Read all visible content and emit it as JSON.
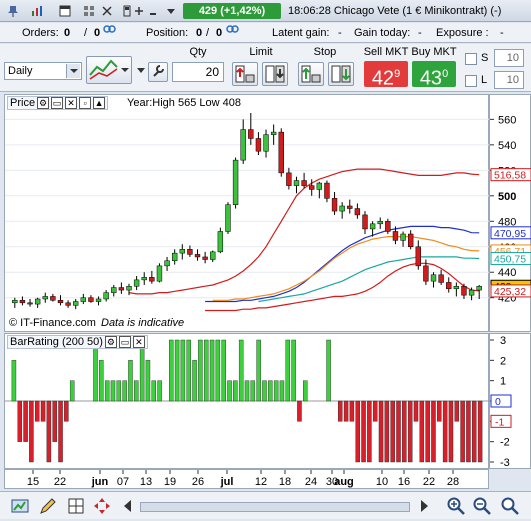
{
  "titlebar": {
    "price": "429 (+1,42%)",
    "title": "18:06:28 Chicago Vete (1 € Minikontrakt) (-)",
    "icons": [
      "pin-icon",
      "chart-icon",
      "window-icon",
      "tile-icon",
      "close-icon",
      "arrow-up-icon",
      "arrow-down-icon",
      "restore-icon",
      "more-icon"
    ]
  },
  "infobar": {
    "orders_label": "Orders:",
    "orders_val1": "0",
    "orders_val2": "0",
    "position_label": "Position:",
    "position_val1": "0",
    "position_val2": "0",
    "latent_label": "Latent gain:",
    "latent_val": "-",
    "gain_label": "Gain today:",
    "gain_val": "-",
    "exposure_label": "Exposure :",
    "exposure_val": "-",
    "sep": "/"
  },
  "toolbar": {
    "period": "Daily",
    "qty_label": "Qty",
    "qty_value": "20",
    "limit_label": "Limit",
    "stop_label": "Stop",
    "sell_label": "Sell MKT",
    "buy_label": "Buy MKT",
    "sell_price_main": "42",
    "sell_price_sup": "9",
    "buy_price_main": "43",
    "buy_price_sup": "0",
    "s_label": "S",
    "l_label": "L",
    "s_value": "10",
    "l_value": "10"
  },
  "price_panel": {
    "title": "Price",
    "info": "Year:High 565 Low 408",
    "copyright": "© IT-Finance.com",
    "indicative": "Data is indicative",
    "yticks": [
      "560",
      "540",
      "520",
      "500",
      "480",
      "460",
      "440",
      "420"
    ],
    "tags": [
      {
        "text": "516,58",
        "color": "#d01c1c",
        "value": 516.58
      },
      {
        "text": "470,95",
        "color": "#1d2fd0",
        "value": 470.95
      },
      {
        "text": "456,71",
        "color": "#f08a1a",
        "value": 456.71
      },
      {
        "text": "450,75",
        "color": "#1aa7a0",
        "value": 450.75
      },
      {
        "text": "429",
        "color": "#000000",
        "value": 429,
        "bg": "#f5c400"
      },
      {
        "text": "425,32",
        "color": "#d01c1c",
        "value": 425.32
      }
    ]
  },
  "bar_panel": {
    "title": "BarRating (200 50)",
    "yticks": [
      "3",
      "2",
      "1",
      "0",
      "-1",
      "-2",
      "-3"
    ],
    "zero_tag": "0",
    "neg_tag": "-1"
  },
  "xaxis": {
    "labels": [
      "15",
      "22",
      "jun",
      "07",
      "13",
      "19",
      "26",
      "jul",
      "12",
      "18",
      "24",
      "30",
      "aug",
      "10",
      "16",
      "22",
      "28"
    ]
  },
  "chart_data": {
    "type": "line",
    "title": "",
    "info": "Year:High 565 Low 408",
    "ylim": [
      408,
      565
    ],
    "x_labels": [
      "15",
      "22",
      "jun",
      "07",
      "13",
      "19",
      "26",
      "jul",
      "12",
      "18",
      "24",
      "30",
      "aug",
      "10",
      "16",
      "22",
      "28"
    ],
    "candles": [
      [
        416,
        420,
        412,
        418
      ],
      [
        418,
        421,
        414,
        416
      ],
      [
        416,
        419,
        413,
        415
      ],
      [
        415,
        420,
        412,
        419
      ],
      [
        419,
        424,
        416,
        421
      ],
      [
        421,
        423,
        417,
        418
      ],
      [
        418,
        422,
        414,
        416
      ],
      [
        416,
        418,
        412,
        414
      ],
      [
        414,
        419,
        411,
        417
      ],
      [
        417,
        423,
        415,
        420
      ],
      [
        420,
        422,
        416,
        417
      ],
      [
        417,
        421,
        414,
        419
      ],
      [
        419,
        426,
        417,
        424
      ],
      [
        424,
        430,
        421,
        428
      ],
      [
        428,
        432,
        423,
        426
      ],
      [
        426,
        431,
        422,
        429
      ],
      [
        429,
        437,
        426,
        434
      ],
      [
        434,
        440,
        430,
        436
      ],
      [
        436,
        441,
        431,
        433
      ],
      [
        433,
        447,
        432,
        445
      ],
      [
        445,
        452,
        441,
        449
      ],
      [
        449,
        458,
        446,
        455
      ],
      [
        455,
        462,
        450,
        458
      ],
      [
        458,
        461,
        452,
        454
      ],
      [
        454,
        458,
        449,
        452
      ],
      [
        452,
        456,
        447,
        450
      ],
      [
        450,
        457,
        448,
        456
      ],
      [
        456,
        475,
        455,
        472
      ],
      [
        472,
        495,
        470,
        493
      ],
      [
        493,
        530,
        490,
        528
      ],
      [
        528,
        560,
        525,
        552
      ],
      [
        552,
        565,
        540,
        545
      ],
      [
        545,
        550,
        532,
        535
      ],
      [
        535,
        552,
        530,
        548
      ],
      [
        548,
        556,
        540,
        550
      ],
      [
        550,
        553,
        515,
        518
      ],
      [
        518,
        522,
        505,
        508
      ],
      [
        508,
        515,
        502,
        512
      ],
      [
        512,
        518,
        506,
        508
      ],
      [
        508,
        513,
        500,
        505
      ],
      [
        505,
        511,
        498,
        510
      ],
      [
        510,
        512,
        495,
        498
      ],
      [
        498,
        503,
        485,
        488
      ],
      [
        488,
        495,
        482,
        492
      ],
      [
        492,
        497,
        486,
        490
      ],
      [
        490,
        494,
        482,
        485
      ],
      [
        485,
        488,
        470,
        474
      ],
      [
        474,
        480,
        468,
        478
      ],
      [
        478,
        483,
        474,
        480
      ],
      [
        480,
        482,
        470,
        472
      ],
      [
        472,
        476,
        462,
        465
      ],
      [
        465,
        472,
        460,
        470
      ],
      [
        470,
        473,
        458,
        460
      ],
      [
        460,
        465,
        442,
        445
      ],
      [
        445,
        450,
        430,
        433
      ],
      [
        433,
        440,
        428,
        438
      ],
      [
        438,
        442,
        430,
        432
      ],
      [
        432,
        436,
        424,
        427
      ],
      [
        427,
        432,
        421,
        429
      ],
      [
        429,
        431,
        419,
        422
      ],
      [
        422,
        428,
        418,
        426
      ],
      [
        426,
        430,
        419,
        429
      ]
    ],
    "series": [
      {
        "name": "",
        "color": "#d01c1c",
        "values": [
          424,
          423,
          423,
          423,
          424,
          424,
          425,
          426,
          427,
          428,
          429,
          430,
          432,
          434,
          437,
          441,
          446,
          452,
          460,
          470,
          480,
          490,
          500,
          506,
          510,
          513,
          515,
          517,
          519,
          520,
          521,
          521,
          521,
          521,
          520,
          519,
          518,
          517,
          516,
          516,
          516,
          516,
          517,
          518,
          518,
          517,
          516.58
        ]
      },
      {
        "name": "",
        "color": "#1d2fd0",
        "values": [
          417,
          417,
          417,
          417,
          417,
          418,
          418,
          419,
          420,
          421,
          423,
          425,
          428,
          432,
          437,
          442,
          447,
          452,
          457,
          461,
          464,
          467,
          469,
          471,
          473,
          474,
          475,
          476,
          476,
          476,
          476,
          475,
          475,
          474,
          473,
          471,
          470.95
        ]
      },
      {
        "name": "",
        "color": "#f08a1a",
        "values": [
          418,
          418,
          418,
          419,
          419,
          420,
          421,
          422,
          423,
          425,
          427,
          430,
          433,
          437,
          441,
          446,
          451,
          455,
          459,
          462,
          464,
          466,
          467,
          468,
          468,
          468,
          468,
          467,
          466,
          465,
          463,
          461,
          460,
          458,
          457,
          456.71
        ]
      },
      {
        "name": "",
        "color": "#1aa7a0",
        "values": [
          417,
          418,
          419,
          420,
          421,
          422,
          423,
          425,
          427,
          429,
          431,
          433,
          436,
          439,
          442,
          444,
          446,
          448,
          449,
          450,
          451,
          452,
          452,
          452,
          452,
          452,
          452,
          451,
          451,
          450.75
        ]
      },
      {
        "name": "",
        "color": "#d01c1c",
        "values": [
          410,
          410,
          410,
          410,
          410,
          411,
          411,
          412,
          412,
          413,
          414,
          415,
          416,
          417,
          418,
          419,
          420,
          421,
          421,
          422,
          423,
          425,
          428,
          432,
          437,
          441,
          444,
          446,
          447,
          447,
          446,
          443,
          439,
          434,
          429,
          426,
          425.32
        ]
      }
    ],
    "bar_rating": {
      "ylim": [
        -3,
        3
      ],
      "values": [
        2,
        -2,
        -2,
        -3,
        -1,
        -1,
        -3,
        -2,
        -3,
        -1,
        1,
        0,
        0,
        0,
        3,
        2,
        1,
        1,
        1,
        1,
        2,
        1,
        3,
        2,
        1,
        1,
        0,
        3,
        3,
        3,
        3,
        2,
        3,
        3,
        3,
        3,
        3,
        1,
        1,
        3,
        1,
        1,
        3,
        1,
        1,
        1,
        1,
        3,
        3,
        -1,
        1,
        0,
        0,
        0,
        3,
        0,
        -1,
        -1,
        -1,
        -3,
        -3,
        -3,
        -1,
        -3,
        -3,
        -3,
        -3,
        -3,
        -3,
        -1,
        -3,
        -3,
        -3,
        -1,
        -3,
        -3,
        -1,
        -3,
        -3,
        -3,
        -3
      ]
    }
  }
}
